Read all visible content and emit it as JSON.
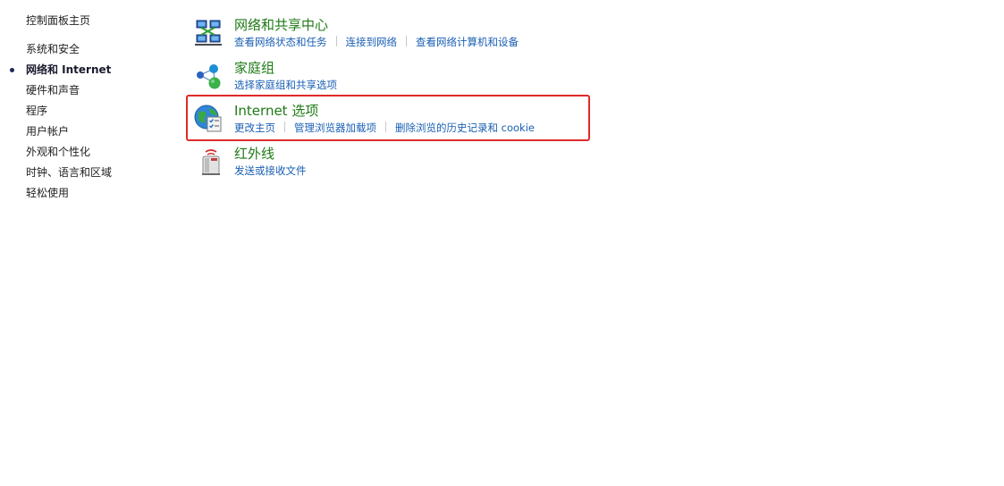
{
  "nav": {
    "home_label": "控制面板主页",
    "items": [
      {
        "label": "系统和安全",
        "current": false
      },
      {
        "label": "网络和 Internet",
        "current": true
      },
      {
        "label": "硬件和声音",
        "current": false
      },
      {
        "label": "程序",
        "current": false
      },
      {
        "label": "用户帐户",
        "current": false
      },
      {
        "label": "外观和个性化",
        "current": false
      },
      {
        "label": "时钟、语言和区域",
        "current": false
      },
      {
        "label": "轻松使用",
        "current": false
      }
    ]
  },
  "categories": [
    {
      "title": "网络和共享中心",
      "icon": "network-sharing-center-icon",
      "links": [
        "查看网络状态和任务",
        "连接到网络",
        "查看网络计算机和设备"
      ]
    },
    {
      "title": "家庭组",
      "icon": "homegroup-icon",
      "links": [
        "选择家庭组和共享选项"
      ]
    },
    {
      "title": "Internet 选项",
      "icon": "internet-options-icon",
      "links": [
        "更改主页",
        "管理浏览器加载项",
        "删除浏览的历史记录和 cookie"
      ],
      "highlighted": true
    },
    {
      "title": "红外线",
      "icon": "infrared-icon",
      "links": [
        "发送或接收文件"
      ]
    }
  ],
  "colors": {
    "title_green": "#1e7a16",
    "link_blue": "#1a5fb4",
    "highlight_red": "#e02a2a"
  }
}
